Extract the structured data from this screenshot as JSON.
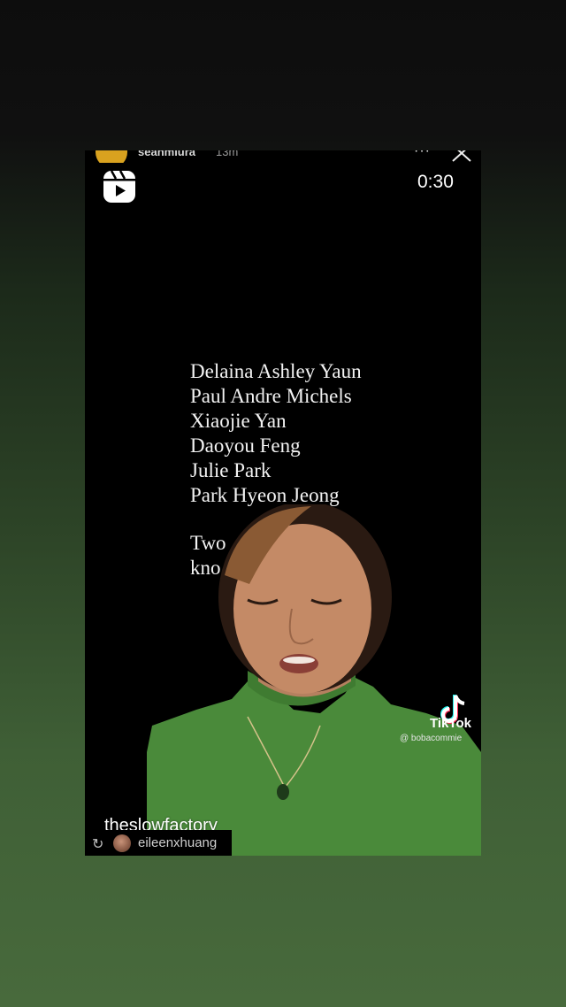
{
  "story": {
    "username": "seanmiura",
    "time_ago": "13m",
    "timer": "0:30",
    "more_label": "···"
  },
  "video": {
    "names": [
      "Delaina Ashley Yaun",
      "Paul Andre Michels",
      "Xiaojie Yan",
      "Daoyou Feng",
      "Julie Park",
      "Park Hyeon Jeong"
    ],
    "overlay_line1": "Two                 not",
    "overlay_line2": "kno",
    "tiktok_label": "TikTok",
    "tiktok_handle": "@ bobacommie"
  },
  "sticker": {
    "mention": "theslowfactory"
  },
  "repost": {
    "username": "eileenxhuang"
  },
  "colors": {
    "sweater": "#4a8a3a",
    "avatar_ring": "#d9a21f",
    "background_bottom": "#486a3c"
  }
}
